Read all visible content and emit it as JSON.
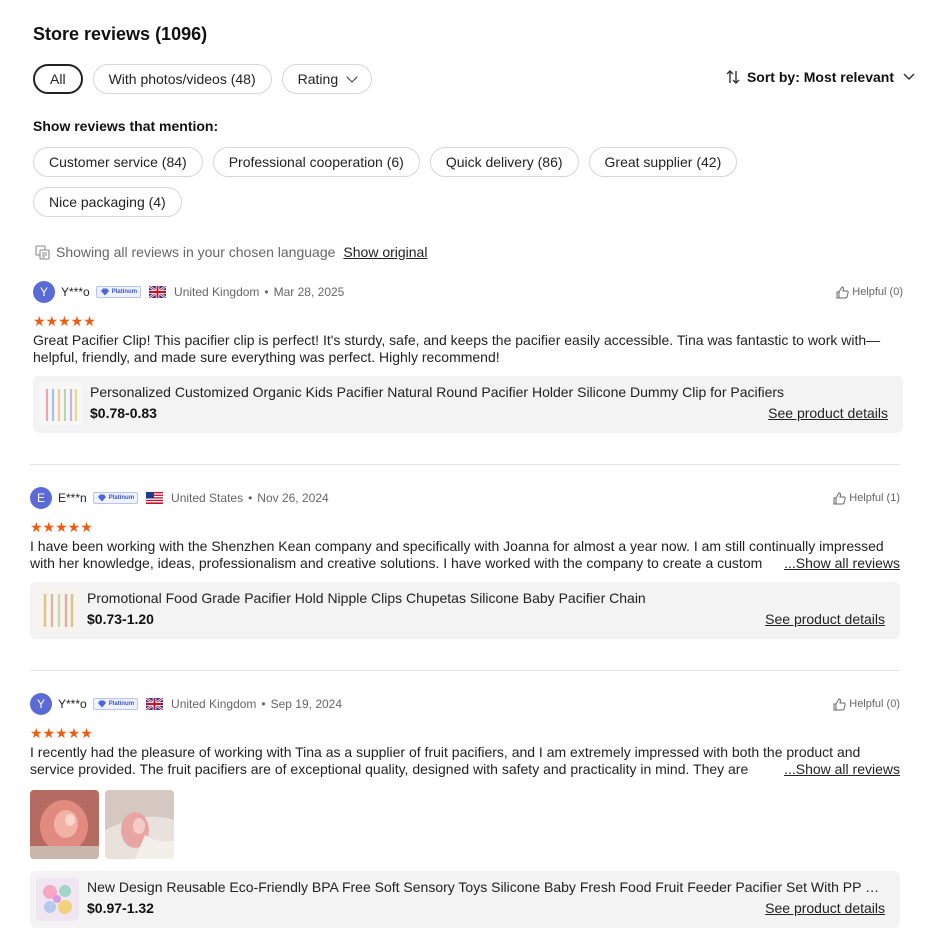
{
  "header": {
    "title": "Store reviews (1096)"
  },
  "filters": {
    "all": "All",
    "photos": "With photos/videos (48)",
    "rating": "Rating"
  },
  "sort": {
    "label": "Sort by: Most relevant"
  },
  "mentions": {
    "label": "Show reviews that mention:",
    "items": [
      "Customer service (84)",
      "Professional cooperation (6)",
      "Quick delivery (86)",
      "Great supplier (42)",
      "Nice packaging (4)"
    ]
  },
  "language": {
    "text": "Showing all reviews in your chosen language",
    "link": "Show original"
  },
  "badge_text": "Platinum",
  "reviews": [
    {
      "initial": "Y",
      "user": "Y***o",
      "country": "United Kingdom",
      "date": "Mar 28, 2025",
      "helpful": "Helpful (0)",
      "stars": "★★★★★",
      "text": "Great Pacifier Clip! This pacifier clip is perfect! It's sturdy, safe, and keeps the pacifier easily accessible. Tina was fantastic to work with—helpful, friendly, and made sure everything was perfect. Highly recommend!",
      "product": {
        "name": "Personalized Customized Organic Kids Pacifier Natural Round Pacifier Holder Silicone Dummy Clip for Pacifiers",
        "price": "$0.78-0.83",
        "details": "See product details"
      }
    },
    {
      "initial": "E",
      "user": "E***n",
      "country": "United States",
      "date": "Nov 26, 2024",
      "helpful": "Helpful (1)",
      "stars": "★★★★★",
      "text": "I have been working with the Shenzhen Kean company and specifically with Joanna for almost a year now. I am still continually impressed with her knowledge, ideas, professionalism and creative solutions. I have worked with the company to create a custom",
      "show_all": "...Show all reviews",
      "product": {
        "name": "Promotional Food Grade Pacifier Hold Nipple Clips Chupetas Silicone Baby Pacifier Chain",
        "price": "$0.73-1.20",
        "details": "See product details"
      }
    },
    {
      "initial": "Y",
      "user": "Y***o",
      "country": "United Kingdom",
      "date": "Sep 19, 2024",
      "helpful": "Helpful (0)",
      "stars": "★★★★★",
      "text": "I recently had the pleasure of working with Tina as a supplier of fruit pacifiers, and I am extremely impressed with both the product and service provided. The fruit pacifiers are of exceptional quality, designed with safety and practicality in mind. They are",
      "show_all": "...Show all reviews",
      "product": {
        "name": "New Design Reusable Eco-Friendly BPA Free Soft Sensory Toys Silicone Baby Fresh Food Fruit Feeder Pacifier Set With PP Handle",
        "price": "$0.97-1.32",
        "details": "See product details"
      }
    }
  ],
  "colors": {
    "star": "#ef5b12",
    "avatar": "#5a6bd6",
    "product_bg": "#f3f3f3"
  }
}
